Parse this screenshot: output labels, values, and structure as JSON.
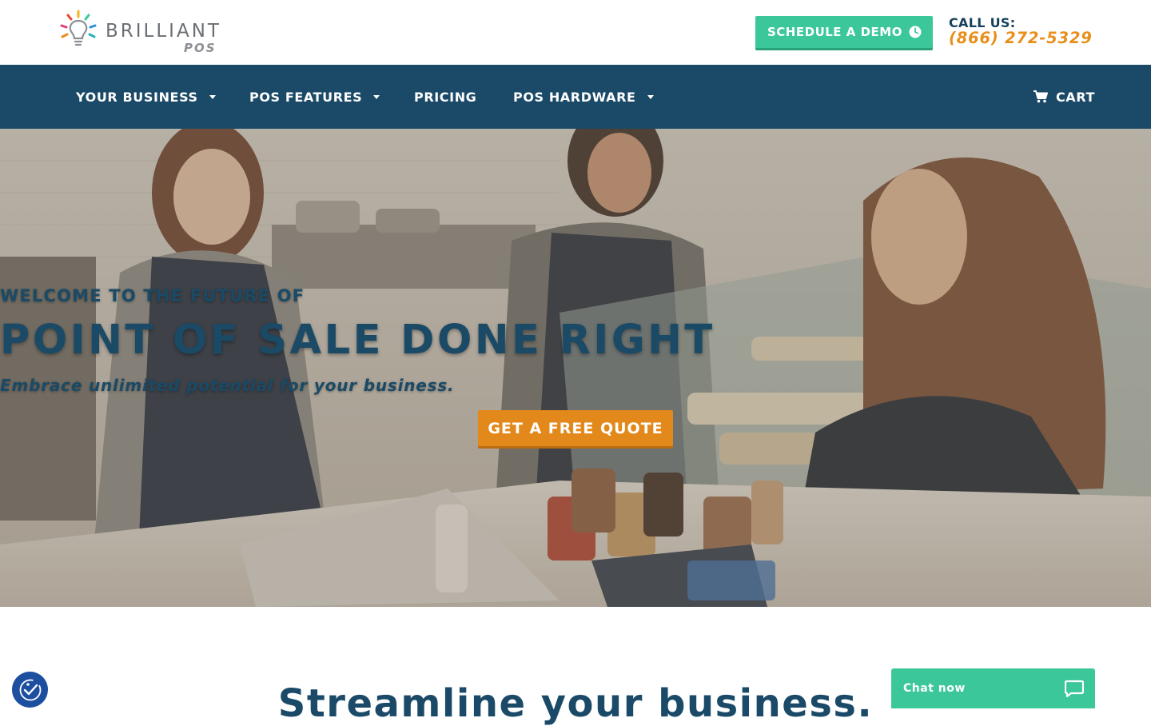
{
  "header": {
    "logo_text": "BRILLIANT",
    "logo_subtext": "POS",
    "demo_button": "SCHEDULE A DEMO",
    "demo_icon": "clock-icon",
    "call_label": "CALL US:",
    "phone": "(866) 272-5329"
  },
  "nav": {
    "items": [
      {
        "label": "YOUR BUSINESS",
        "dropdown": true
      },
      {
        "label": "POS FEATURES",
        "dropdown": true
      },
      {
        "label": "PRICING",
        "dropdown": false
      },
      {
        "label": "POS HARDWARE",
        "dropdown": true
      }
    ],
    "cart_label": "CART",
    "cart_icon": "shopping-cart-icon"
  },
  "hero": {
    "kicker": "WELCOME TO THE FUTURE OF",
    "headline": "POINT OF SALE DONE RIGHT",
    "tagline": "Embrace unlimited potential for your business.",
    "cta": "GET A FREE QUOTE"
  },
  "section": {
    "title": "Streamline your business."
  },
  "widgets": {
    "accessibility_icon": "accessibility-icon",
    "chat_label": "Chat now",
    "chat_icon": "chat-bubble-icon"
  },
  "colors": {
    "brand_blue": "#1b4a68",
    "accent_green": "#3cc79a",
    "accent_orange": "#e3891c",
    "phone_orange": "#e88f1c"
  }
}
